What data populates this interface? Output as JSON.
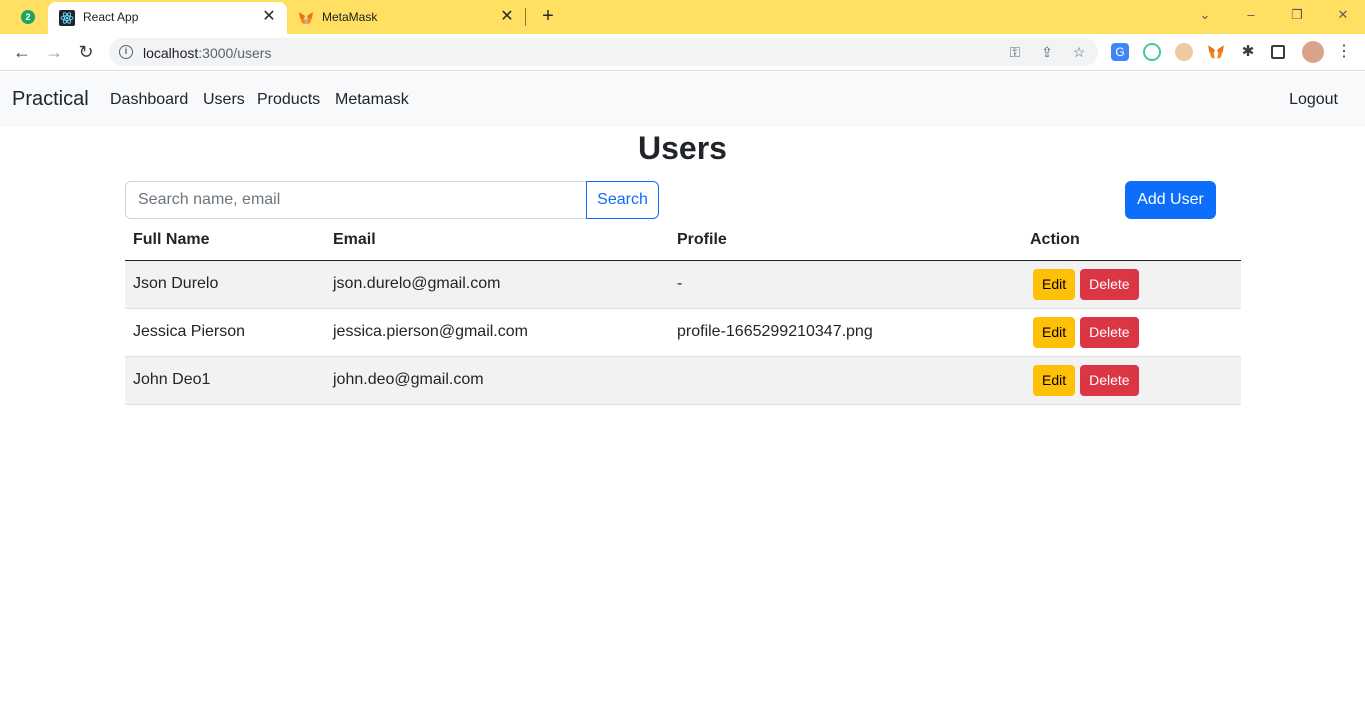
{
  "browser": {
    "tab_counter": "2",
    "tabs": [
      {
        "title": "React App",
        "icon": "react-icon"
      },
      {
        "title": "MetaMask",
        "icon": "metamask-fox-icon"
      }
    ],
    "url_host": "localhost",
    "url_path": ":3000/users",
    "extension_icons": [
      "google-translate-icon",
      "colorzilla-icon",
      "owl-icon",
      "metamask-fox-icon",
      "puzzle-icon",
      "side-panel-icon",
      "profile-avatar-icon"
    ]
  },
  "navbar": {
    "brand": "Practical",
    "links": [
      "Dashboard",
      "Users",
      "Products",
      "Metamask"
    ],
    "logout": "Logout"
  },
  "page": {
    "title": "Users",
    "search_placeholder": "Search name, email",
    "search_value": "",
    "search_button": "Search",
    "add_button": "Add User"
  },
  "table": {
    "headers": [
      "Full Name",
      "Email",
      "Profile",
      "Action"
    ],
    "rows": [
      {
        "name": "Json Durelo",
        "email": "json.durelo@gmail.com",
        "profile": "-"
      },
      {
        "name": "Jessica Pierson",
        "email": "jessica.pierson@gmail.com",
        "profile": "profile-1665299210347.png"
      },
      {
        "name": "John Deo1",
        "email": "john.deo@gmail.com",
        "profile": ""
      }
    ],
    "edit_label": "Edit",
    "delete_label": "Delete"
  },
  "colors": {
    "primary": "#0d6efd",
    "warning": "#ffc107",
    "danger": "#dc3545",
    "tabstrip": "#ffe063"
  }
}
